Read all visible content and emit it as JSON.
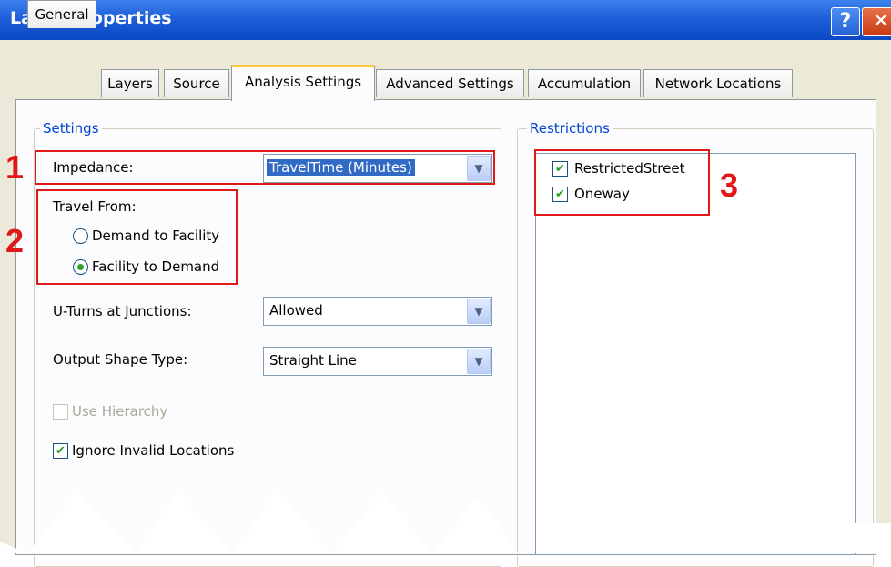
{
  "window": {
    "title": "Layer Properties",
    "help_glyph": "?",
    "close_glyph": "✕"
  },
  "tabs": [
    {
      "label": "General"
    },
    {
      "label": "Layers"
    },
    {
      "label": "Source"
    },
    {
      "label": "Analysis Settings",
      "active": true
    },
    {
      "label": "Advanced Settings"
    },
    {
      "label": "Accumulation"
    },
    {
      "label": "Network Locations"
    }
  ],
  "settings": {
    "group_label": "Settings",
    "impedance": {
      "label": "Impedance:",
      "value": "TravelTime (Minutes)"
    },
    "travel_from": {
      "label": "Travel From:",
      "options": [
        {
          "label": "Demand to Facility",
          "selected": false
        },
        {
          "label": "Facility to Demand",
          "selected": true
        }
      ]
    },
    "uturns": {
      "label": "U-Turns at Junctions:",
      "value": "Allowed"
    },
    "output_shape": {
      "label": "Output Shape Type:",
      "value": "Straight Line"
    },
    "use_hierarchy": {
      "label": "Use Hierarchy",
      "checked": false,
      "enabled": false
    },
    "ignore_invalid": {
      "label": "Ignore Invalid Locations",
      "checked": true
    }
  },
  "restrictions": {
    "group_label": "Restrictions",
    "items": [
      {
        "label": "RestrictedStreet",
        "checked": true
      },
      {
        "label": "Oneway",
        "checked": true
      }
    ]
  },
  "annotations": [
    "1",
    "2",
    "3"
  ],
  "colors": {
    "annotation": "#e01818",
    "titlebar": "#0a48c4",
    "group_label": "#0046d5"
  },
  "icons": {
    "dropdown": "chevron-down-icon",
    "check": "checkmark-icon"
  },
  "glyphs": {
    "check": "✔",
    "arrow": "▼"
  }
}
